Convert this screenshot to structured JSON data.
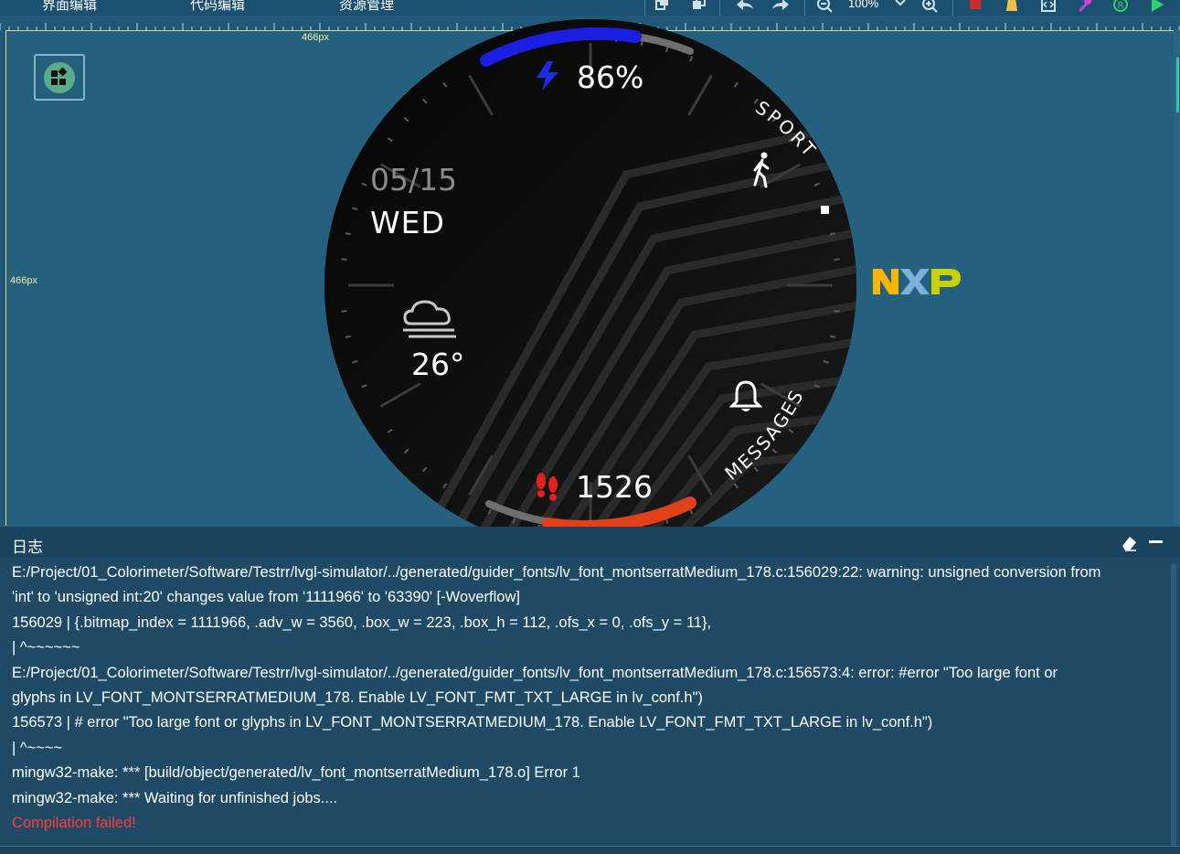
{
  "toolbar": {
    "tabs": [
      "界面编辑",
      "代码编辑",
      "资源管理"
    ],
    "zoom_level": "100%",
    "icons": [
      "copy-icon",
      "paste-icon",
      "undo-icon",
      "redo-icon",
      "zoom-out-icon",
      "zoom-dropdown-icon",
      "zoom-in-icon",
      "stop-icon",
      "clean-icon",
      "code-icon",
      "build-icon",
      "register-icon",
      "run-icon"
    ]
  },
  "canvas": {
    "width_label": "466px",
    "height_label": "466px"
  },
  "watch": {
    "battery": "86%",
    "date": "05/15",
    "day": "WED",
    "temperature": "26°",
    "steps": "1526",
    "sport_label": "SPORT",
    "messages_label": "MESSAGES",
    "colors": {
      "battery_arc": "#1a1ee0",
      "steps_arc": "#e0401a",
      "track": "#6f6f6f"
    }
  },
  "logo": "NXP",
  "log": {
    "title": "日志",
    "lines": [
      "E:/Project/01_Colorimeter/Software/Testrr/lvgl-simulator/../generated/guider_fonts/lv_font_montserratMedium_178.c:156029:22: warning: unsigned conversion from",
      "'int' to 'unsigned int:20' changes value from '1111966' to '63390' [-Woverflow]",
      "156029 | {.bitmap_index = 1111966, .adv_w = 3560, .box_w = 223, .box_h = 112, .ofs_x = 0, .ofs_y = 11},",
      "| ^~~~~~~",
      "E:/Project/01_Colorimeter/Software/Testrr/lvgl-simulator/../generated/guider_fonts/lv_font_montserratMedium_178.c:156573:4: error: #error \"Too large font or",
      "glyphs in LV_FONT_MONTSERRATMEDIUM_178. Enable LV_FONT_FMT_TXT_LARGE in lv_conf.h\")",
      "156573 | # error \"Too large font or glyphs in LV_FONT_MONTSERRATMEDIUM_178. Enable LV_FONT_FMT_TXT_LARGE in lv_conf.h\")",
      "| ^~~~~",
      "mingw32-make: *** [build/object/generated/lv_font_montserratMedium_178.o] Error 1",
      "mingw32-make: *** Waiting for unfinished jobs....",
      "Compilation failed!"
    ],
    "status_color_error": "#ff3b3b"
  }
}
